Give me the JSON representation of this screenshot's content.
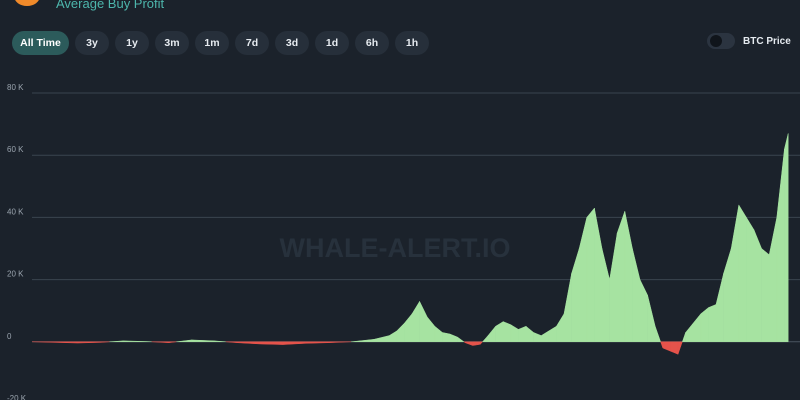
{
  "header": {
    "subtitle": "Average Buy Profit",
    "icon": "bitcoin-icon",
    "icon_color": "#f08a2a"
  },
  "ranges": [
    {
      "label": "All Time",
      "active": true
    },
    {
      "label": "3y"
    },
    {
      "label": "1y"
    },
    {
      "label": "3m"
    },
    {
      "label": "1m"
    },
    {
      "label": "7d"
    },
    {
      "label": "3d"
    },
    {
      "label": "1d"
    },
    {
      "label": "6h"
    },
    {
      "label": "1h"
    }
  ],
  "toggle": {
    "label": "BTC Price",
    "on": false
  },
  "watermark": "WHALE-ALERT.IO",
  "colors": {
    "positive": "#a6e3a1",
    "negative": "#e5534b",
    "grid": "#3a444f",
    "background": "#1b222b"
  },
  "chart_data": {
    "type": "area",
    "title": "",
    "xlabel": "",
    "ylabel": "",
    "ylim": [
      -20000,
      80000
    ],
    "yticks": [
      {
        "value": 80000,
        "label": "80 K"
      },
      {
        "value": 60000,
        "label": "60 K"
      },
      {
        "value": 40000,
        "label": "40 K"
      },
      {
        "value": 20000,
        "label": "20 K"
      },
      {
        "value": 0,
        "label": "0"
      },
      {
        "value": -20000,
        "label": "-20 K"
      }
    ],
    "grid": true,
    "x_index_range": [
      0,
      100
    ],
    "series": [
      {
        "points": [
          [
            0,
            0
          ],
          [
            3,
            -200
          ],
          [
            6,
            -400
          ],
          [
            9,
            -200
          ],
          [
            12,
            300
          ],
          [
            15,
            100
          ],
          [
            18,
            -300
          ],
          [
            21,
            600
          ],
          [
            24,
            300
          ],
          [
            27,
            -300
          ],
          [
            30,
            -700
          ],
          [
            33,
            -900
          ],
          [
            36,
            -500
          ],
          [
            39,
            -300
          ],
          [
            42,
            0
          ],
          [
            45,
            800
          ],
          [
            47,
            2000
          ],
          [
            48,
            3500
          ],
          [
            49,
            6000
          ],
          [
            50,
            9000
          ],
          [
            51,
            13000
          ],
          [
            52,
            8000
          ],
          [
            53,
            5000
          ],
          [
            54,
            3000
          ],
          [
            55,
            2500
          ],
          [
            56,
            1500
          ],
          [
            57,
            -300
          ],
          [
            58,
            -1200
          ],
          [
            59,
            -800
          ],
          [
            60,
            2000
          ],
          [
            61,
            5000
          ],
          [
            62,
            6500
          ],
          [
            63,
            5500
          ],
          [
            64,
            4000
          ],
          [
            65,
            5000
          ],
          [
            66,
            3000
          ],
          [
            67,
            2000
          ],
          [
            68,
            3500
          ],
          [
            69,
            5000
          ],
          [
            70,
            9000
          ],
          [
            71,
            22000
          ],
          [
            72,
            30000
          ],
          [
            73,
            40000
          ],
          [
            74,
            43000
          ],
          [
            75,
            30000
          ],
          [
            76,
            20000
          ],
          [
            77,
            35000
          ],
          [
            78,
            42000
          ],
          [
            79,
            30000
          ],
          [
            80,
            20000
          ],
          [
            81,
            15000
          ],
          [
            82,
            5000
          ],
          [
            83,
            -2000
          ],
          [
            84,
            -3000
          ],
          [
            85,
            -4000
          ],
          [
            86,
            3000
          ],
          [
            87,
            6000
          ],
          [
            88,
            9000
          ],
          [
            89,
            11000
          ],
          [
            90,
            12000
          ],
          [
            91,
            22000
          ],
          [
            92,
            30000
          ],
          [
            93,
            44000
          ],
          [
            94,
            40000
          ],
          [
            95,
            36000
          ],
          [
            96,
            30000
          ],
          [
            97,
            28000
          ],
          [
            98,
            40000
          ],
          [
            99,
            62000
          ],
          [
            99.5,
            67000
          ]
        ]
      }
    ]
  }
}
